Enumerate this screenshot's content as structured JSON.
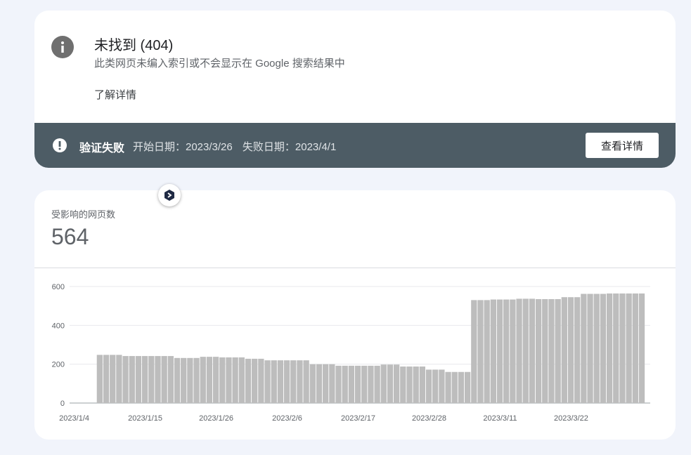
{
  "issue": {
    "title": "未找到 (404)",
    "subtitle": "此类网页未编入索引或不会显示在 Google 搜索结果中",
    "learn_more": "了解详情",
    "icon": "info-icon"
  },
  "validation": {
    "status": "验证失败",
    "start_date": "开始日期：2023/3/26",
    "fail_date": "失败日期：2023/4/1",
    "view_details": "查看详情",
    "icon": "alert-icon",
    "bar_color": "#4d5c65"
  },
  "metric": {
    "label": "受影响的网页数",
    "value": "564"
  },
  "chart_data": {
    "type": "bar",
    "title": "",
    "xlabel": "",
    "ylabel": "",
    "ylim": [
      0,
      600
    ],
    "yticks": [
      0,
      200,
      400,
      600
    ],
    "x_tick_labels": [
      "2023/1/4",
      "2023/1/15",
      "2023/1/26",
      "2023/2/6",
      "2023/2/17",
      "2023/2/28",
      "2023/3/11",
      "2023/3/22"
    ],
    "bar_color": "#bdbdbd",
    "grid": true,
    "start_date": "2023/1/4",
    "values": [
      0,
      0,
      0,
      0,
      248,
      248,
      248,
      248,
      242,
      242,
      242,
      242,
      242,
      242,
      242,
      242,
      232,
      232,
      232,
      232,
      238,
      238,
      238,
      235,
      235,
      235,
      235,
      228,
      228,
      228,
      220,
      220,
      220,
      220,
      220,
      220,
      220,
      200,
      200,
      200,
      200,
      192,
      192,
      192,
      192,
      192,
      192,
      192,
      198,
      198,
      198,
      188,
      188,
      188,
      188,
      172,
      172,
      172,
      160,
      160,
      160,
      160,
      530,
      530,
      530,
      533,
      533,
      533,
      533,
      537,
      537,
      537,
      535,
      535,
      535,
      535,
      545,
      545,
      545,
      562,
      562,
      562,
      562,
      564,
      564,
      564,
      564,
      564,
      564
    ]
  },
  "annotation": {
    "icon": "annotation-icon"
  }
}
